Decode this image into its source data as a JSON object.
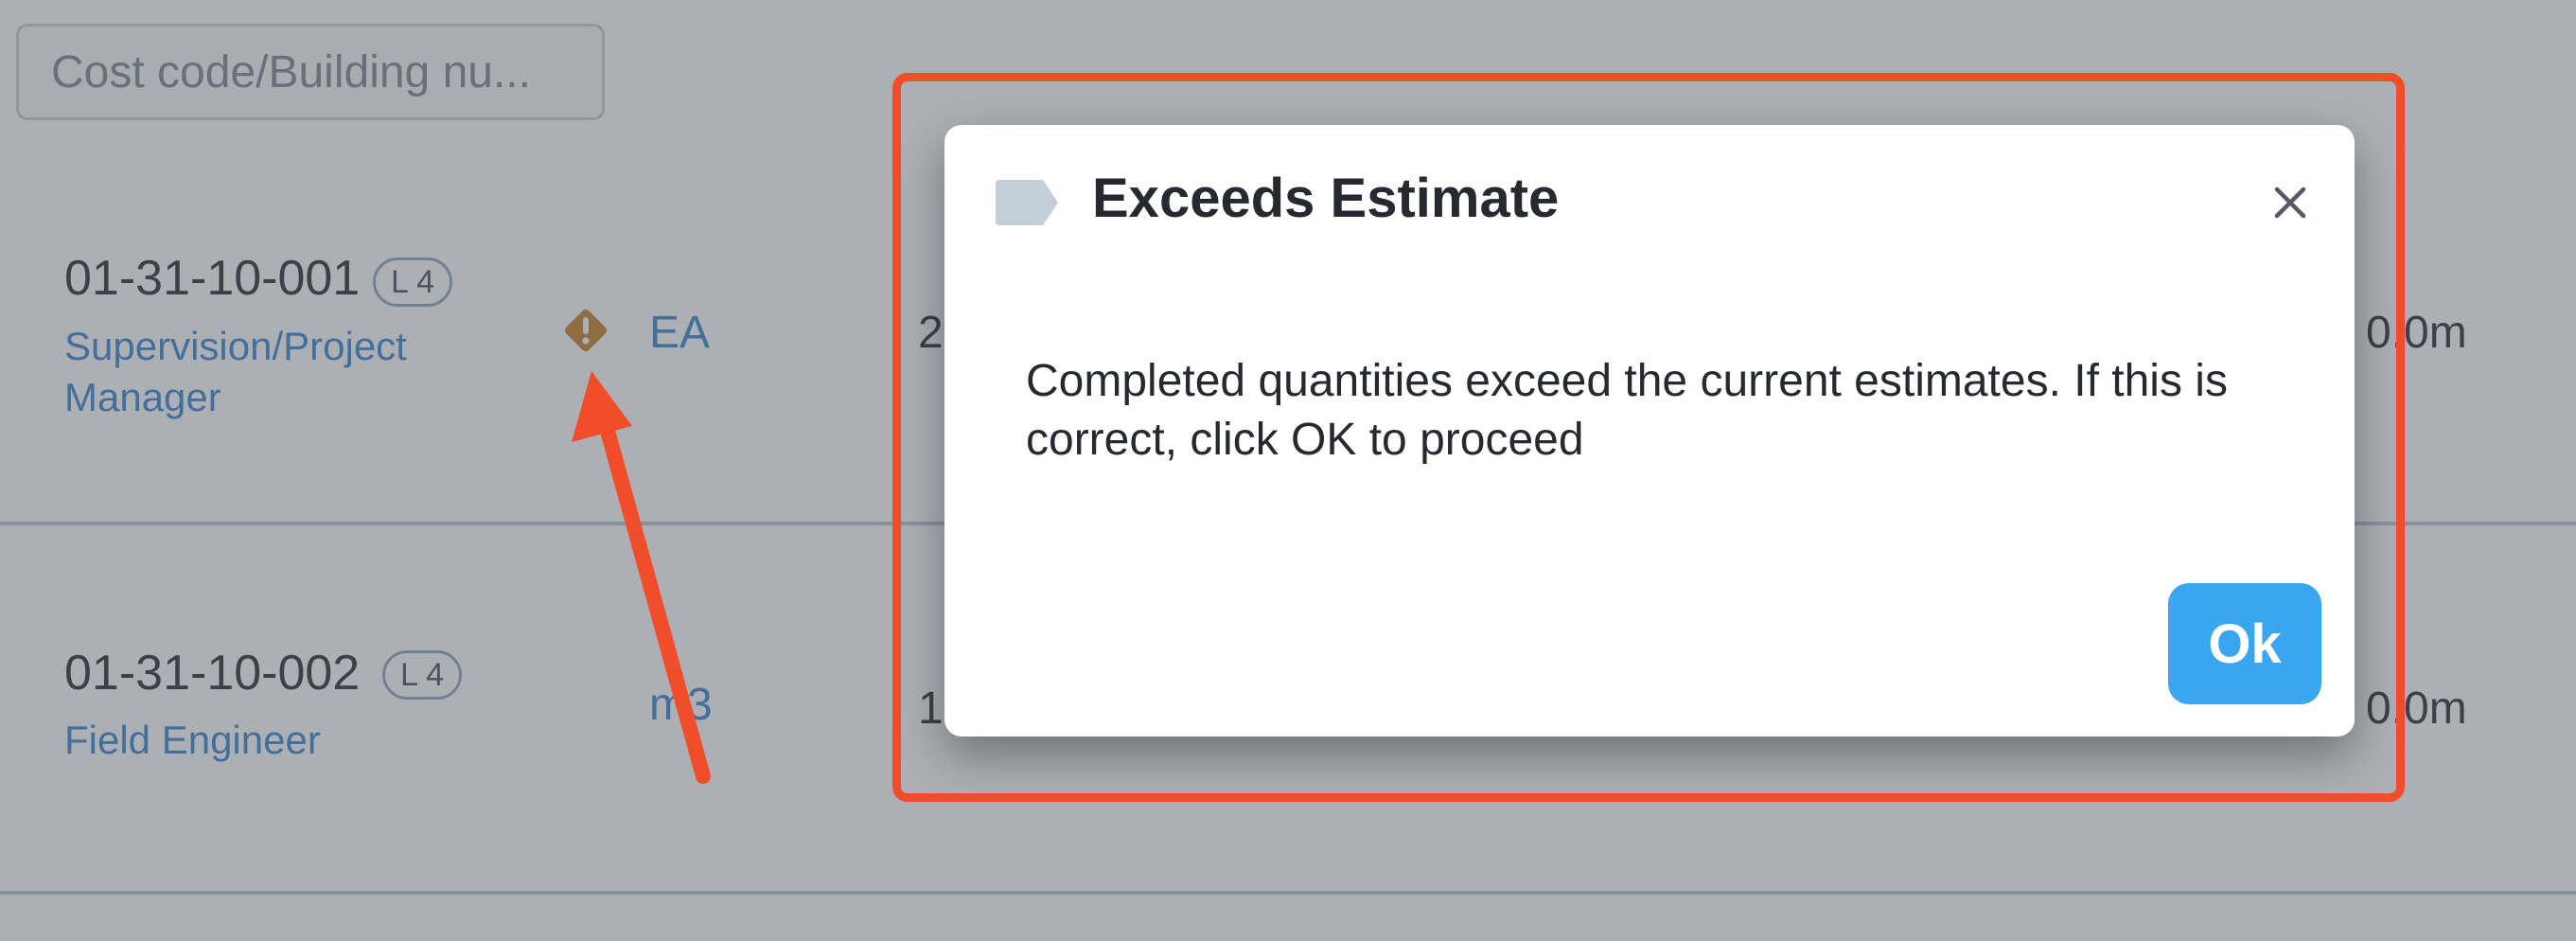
{
  "search": {
    "placeholder": "Cost code/Building nu..."
  },
  "rows": [
    {
      "code": "01-31-10-001",
      "level": "L 4",
      "description_line1": "Supervision/Project",
      "description_line2": "Manager",
      "unit": "EA",
      "quantity_partial": "2",
      "duration_partial": "0.0m",
      "warning_icon": "warning-diamond-icon"
    },
    {
      "code": "01-31-10-002",
      "level": "L 4",
      "description_line1": "Field Engineer",
      "unit": "m3",
      "quantity_partial": "1(",
      "duration_partial": "0.0m"
    }
  ],
  "modal": {
    "title": "Exceeds Estimate",
    "tag_icon": "tag-icon",
    "close_icon": "close-icon",
    "body": "Completed quantities exceed the current estimates. If this is correct, click OK to proceed",
    "ok_label": "Ok"
  },
  "colors": {
    "annotation": "#f04e2b",
    "primary": "#3aa6f0",
    "link": "#2f7fca",
    "warning": "#c7781a"
  }
}
